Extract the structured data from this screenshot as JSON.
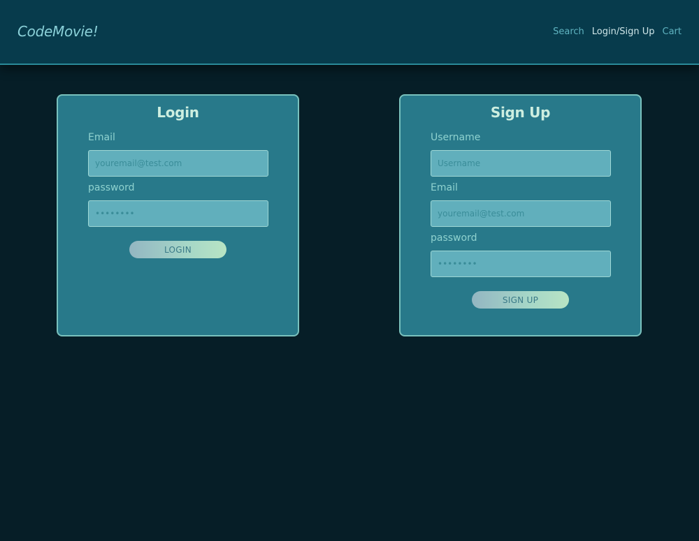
{
  "brand": "CodeMovie!",
  "nav": {
    "search": "Search",
    "login_signup": "Login/Sign Up",
    "cart": "Cart"
  },
  "login": {
    "title": "Login",
    "email_label": "Email",
    "email_placeholder": "youremail@test.com",
    "password_label": "password",
    "password_placeholder": "••••••••",
    "button": "LOGIN"
  },
  "signup": {
    "title": "Sign Up",
    "username_label": "Username",
    "username_placeholder": "Username",
    "email_label": "Email",
    "email_placeholder": "youremail@test.com",
    "password_label": "password",
    "password_placeholder": "••••••••",
    "button": "SIGN UP"
  },
  "colors": {
    "page_background": "#061e27",
    "navbar_background": "#073b4c",
    "card_background": "#28798a",
    "card_border": "#79c1bd",
    "input_background": "#61afbc"
  }
}
